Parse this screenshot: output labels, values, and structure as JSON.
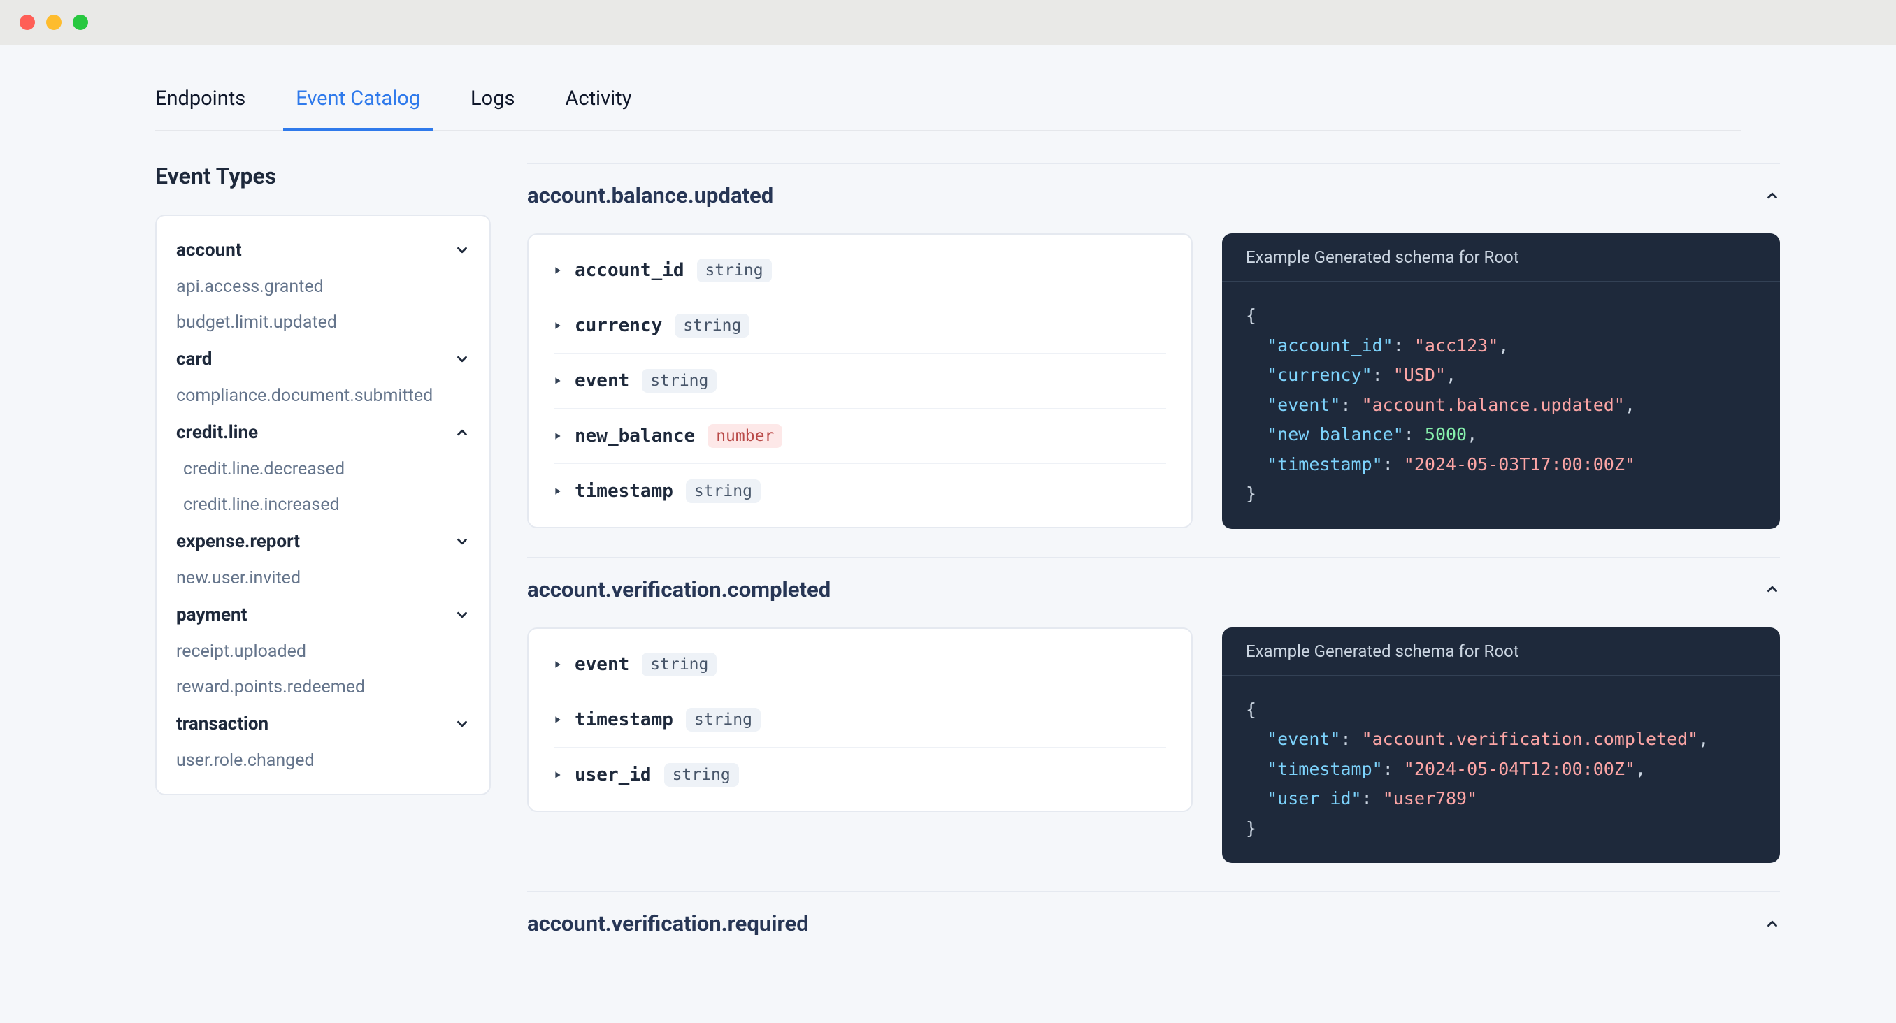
{
  "tabs": {
    "endpoints": "Endpoints",
    "event_catalog": "Event Catalog",
    "logs": "Logs",
    "activity": "Activity"
  },
  "sidebar": {
    "title": "Event Types",
    "items": [
      {
        "label": "account",
        "kind": "cat",
        "expanded": false
      },
      {
        "label": "api.access.granted",
        "kind": "leaf"
      },
      {
        "label": "budget.limit.updated",
        "kind": "leaf"
      },
      {
        "label": "card",
        "kind": "cat",
        "expanded": false
      },
      {
        "label": "compliance.document.submitted",
        "kind": "leaf"
      },
      {
        "label": "credit.line",
        "kind": "cat",
        "expanded": true
      },
      {
        "label": "credit.line.decreased",
        "kind": "leaf",
        "indent": true
      },
      {
        "label": "credit.line.increased",
        "kind": "leaf",
        "indent": true
      },
      {
        "label": "expense.report",
        "kind": "cat",
        "expanded": false
      },
      {
        "label": "new.user.invited",
        "kind": "leaf"
      },
      {
        "label": "payment",
        "kind": "cat",
        "expanded": false
      },
      {
        "label": "receipt.uploaded",
        "kind": "leaf"
      },
      {
        "label": "reward.points.redeemed",
        "kind": "leaf"
      },
      {
        "label": "transaction",
        "kind": "cat",
        "expanded": false
      },
      {
        "label": "user.role.changed",
        "kind": "leaf"
      }
    ]
  },
  "types": {
    "string": "string",
    "number": "number"
  },
  "example_header": "Example Generated schema for Root",
  "events": [
    {
      "name": "account.balance.updated",
      "fields": [
        {
          "name": "account_id",
          "type": "string"
        },
        {
          "name": "currency",
          "type": "string"
        },
        {
          "name": "event",
          "type": "string"
        },
        {
          "name": "new_balance",
          "type": "number"
        },
        {
          "name": "timestamp",
          "type": "string"
        }
      ],
      "example": [
        {
          "key": "account_id",
          "val": "acc123",
          "t": "str"
        },
        {
          "key": "currency",
          "val": "USD",
          "t": "str"
        },
        {
          "key": "event",
          "val": "account.balance.updated",
          "t": "str"
        },
        {
          "key": "new_balance",
          "val": "5000",
          "t": "num"
        },
        {
          "key": "timestamp",
          "val": "2024-05-03T17:00:00Z",
          "t": "str"
        }
      ]
    },
    {
      "name": "account.verification.completed",
      "fields": [
        {
          "name": "event",
          "type": "string"
        },
        {
          "name": "timestamp",
          "type": "string"
        },
        {
          "name": "user_id",
          "type": "string"
        }
      ],
      "example": [
        {
          "key": "event",
          "val": "account.verification.completed",
          "t": "str"
        },
        {
          "key": "timestamp",
          "val": "2024-05-04T12:00:00Z",
          "t": "str"
        },
        {
          "key": "user_id",
          "val": "user789",
          "t": "str"
        }
      ]
    },
    {
      "name": "account.verification.required",
      "fields": [],
      "example": []
    }
  ]
}
